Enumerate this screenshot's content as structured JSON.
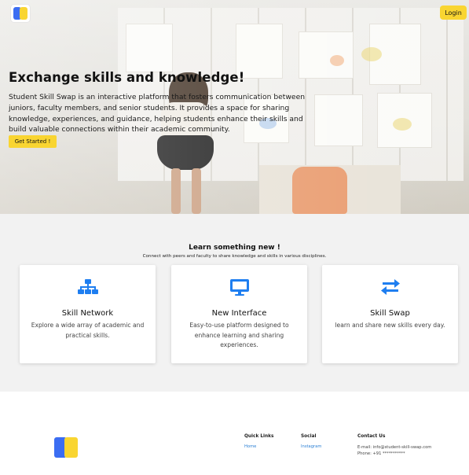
{
  "header": {
    "login_label": "Login"
  },
  "hero": {
    "title": "Exchange skills and knowledge!",
    "description": "Student Skill Swap is an interactive platform that fosters communication between juniors, faculty members, and senior students. It provides a space for sharing knowledge, experiences, and guidance, helping students enhance their skills and build valuable connections within their academic community.",
    "cta_label": "Get Started !"
  },
  "features": {
    "heading": "Learn something new !",
    "subheading": "Connect with peers and faculty to share knowledge and skills in various disciplines.",
    "cards": [
      {
        "icon": "network-icon",
        "title": "Skill Network",
        "text": "Explore a wide array of academic and practical skills."
      },
      {
        "icon": "monitor-icon",
        "title": "New Interface",
        "text": "Easy-to-use platform designed to enhance learning and sharing experiences."
      },
      {
        "icon": "swap-arrows-icon",
        "title": "Skill Swap",
        "text": "learn and share new skills every day."
      }
    ]
  },
  "footer": {
    "quick_links": {
      "heading": "Quick Links",
      "items": [
        "Home"
      ]
    },
    "social": {
      "heading": "Social",
      "items": [
        "Instagram"
      ]
    },
    "contact": {
      "heading": "Contact Us",
      "email": "E-mail: info@student-skill-swap.com",
      "phone": "Phone: +91 ***********"
    }
  },
  "colors": {
    "accent_yellow": "#f9d531",
    "icon_blue": "#1e7ef0",
    "logo_blue": "#3b6df2",
    "link_blue": "#2a7fd4",
    "features_bg": "#f2f2f2"
  }
}
